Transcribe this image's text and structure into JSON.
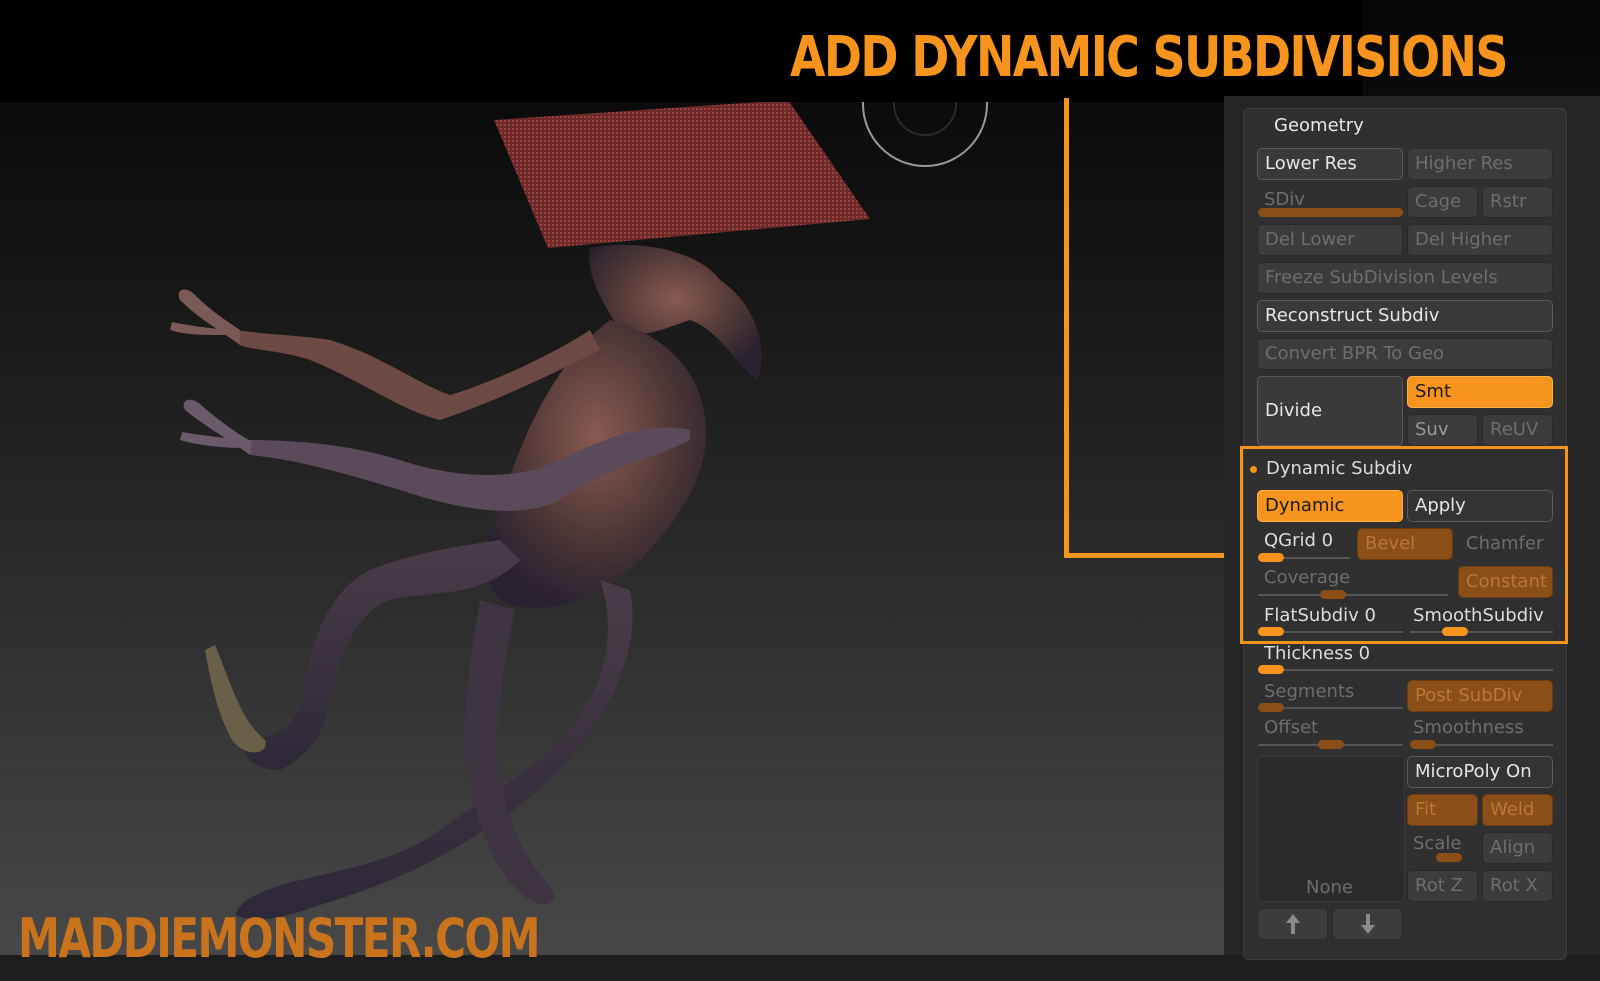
{
  "banner": {
    "title": "ADD DYNAMIC SUBDIVISIONS"
  },
  "watermark": "MADDIEMONSTER.COM",
  "panel": {
    "title": "Geometry",
    "lower_res": "Lower Res",
    "higher_res": "Higher Res",
    "sdiv": "SDiv",
    "cage": "Cage",
    "rstr": "Rstr",
    "del_lower": "Del Lower",
    "del_higher": "Del Higher",
    "freeze": "Freeze SubDivision Levels",
    "reconstruct": "Reconstruct Subdiv",
    "convert_bpr": "Convert BPR To Geo",
    "divide": "Divide",
    "smt": "Smt",
    "suv": "Suv",
    "reuv": "ReUV",
    "dynamic_section": "Dynamic Subdiv",
    "dynamic": "Dynamic",
    "apply": "Apply",
    "qgrid": "QGrid 0",
    "bevel": "Bevel",
    "chamfer": "Chamfer",
    "coverage": "Coverage",
    "constant": "Constant",
    "flat_subdiv": "FlatSubdiv 0",
    "smooth_subdiv": "SmoothSubdiv",
    "thickness": "Thickness 0",
    "segments": "Segments",
    "post_subdiv": "Post SubDiv",
    "offset": "Offset",
    "smoothness": "Smoothness",
    "micropoly": "MicroPoly On",
    "fit": "Fit",
    "weld": "Weld",
    "scale": "Scale",
    "align": "Align",
    "rotz": "Rot Z",
    "rotx": "Rot X",
    "none": "None",
    "up_icon": "arrow-up-icon",
    "down_icon": "arrow-down-icon"
  },
  "colors": {
    "accent": "#f7941d",
    "panel": "#303030",
    "button": "#3c3c3c"
  }
}
